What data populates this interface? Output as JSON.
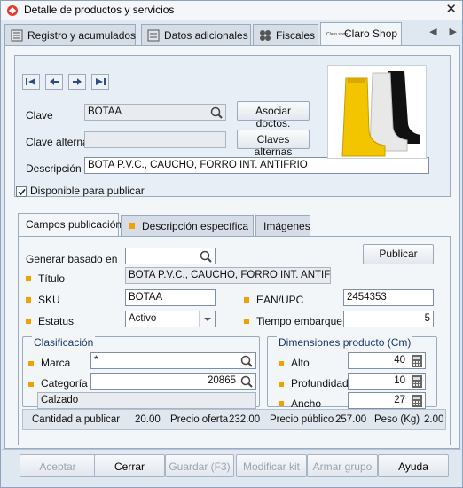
{
  "window": {
    "title": "Detalle de productos y servicios"
  },
  "tabs": [
    {
      "label": "Registro y acumulados"
    },
    {
      "label": "Datos adicionales"
    },
    {
      "label": "Fiscales"
    },
    {
      "label": "Claro Shop",
      "logo_text": "Claro shop"
    }
  ],
  "product": {
    "clave_label": "Clave",
    "clave_value": "BOTAA",
    "clave_alterna_label": "Clave alterna",
    "clave_alterna_value": "",
    "descripcion_label": "Descripción",
    "descripcion_value": "BOTA P.V.C., CAUCHO, FORRO INT. ANTIFRIO",
    "asociar_button": "Asociar doctos.",
    "claves_button": "Claves alternas",
    "disponible_label": "Disponible para publicar",
    "disponible_checked": true
  },
  "subtabs": [
    {
      "label": "Campos publicación"
    },
    {
      "label": "Descripción específica"
    },
    {
      "label": "Imágenes"
    }
  ],
  "publicacion": {
    "generar_label": "Generar basado en",
    "generar_value": "",
    "publicar_button": "Publicar",
    "titulo_label": "Título",
    "titulo_value": "BOTA P.V.C., CAUCHO, FORRO INT. ANTIFRIO",
    "sku_label": "SKU",
    "sku_value": "BOTAA",
    "ean_label": "EAN/UPC",
    "ean_value": "2454353",
    "estatus_label": "Estatus",
    "estatus_value": "Activo",
    "tiempo_label": "Tiempo embarque",
    "tiempo_value": "5"
  },
  "clasificacion": {
    "title": "Clasificación",
    "marca_label": "Marca",
    "marca_value": "*",
    "categoria_label": "Categoría",
    "categoria_value": "20865",
    "categoria_name": "Calzado"
  },
  "dimensiones": {
    "title": "Dimensiones producto (Cm)",
    "alto_label": "Alto",
    "alto_value": "40",
    "profundidad_label": "Profundidad",
    "profundidad_value": "10",
    "ancho_label": "Ancho",
    "ancho_value": "27"
  },
  "summary": {
    "cantidad_label": "Cantidad a publicar",
    "cantidad_value": "20.00",
    "oferta_label": "Precio oferta",
    "oferta_value": "232.00",
    "publico_label": "Precio público",
    "publico_value": "257.00",
    "peso_label": "Peso (Kg)",
    "peso_value": "2.00"
  },
  "buttons": {
    "aceptar": "Aceptar",
    "cerrar": "Cerrar",
    "guardar": "Guardar (F3)",
    "modificar": "Modificar kit",
    "armar": "Armar grupo",
    "ayuda": "Ayuda"
  },
  "colors": {
    "required_marker": "#f2a100",
    "accent": "#3a6ea5"
  }
}
